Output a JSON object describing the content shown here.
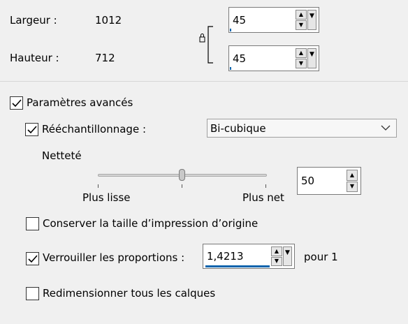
{
  "dimensions": {
    "width_label": "Largeur :",
    "width_value": "1012",
    "height_label": "Hauteur :",
    "height_value": "712",
    "width_spin_value": "45",
    "height_spin_value": "45",
    "lock_icon": "lock-icon"
  },
  "advanced": {
    "checkbox_label": "Paramètres avancés",
    "checked": true,
    "resample_label": "Rééchantillonnage :",
    "resample_checked": true,
    "resample_method": "Bi-cubique",
    "sharpness_label": "Netteté",
    "sharpness_value": "50",
    "sharpness_level_percent": 50,
    "slider_min_label": "Plus lisse",
    "slider_max_label": "Plus net",
    "keep_print_size_label": "Conserver la taille d’impression d’origine",
    "keep_print_size_checked": false,
    "lock_ratio_label": "Verrouiller les proportions :",
    "lock_ratio_checked": true,
    "ratio_value": "1,4213",
    "ratio_suffix": "pour 1",
    "resize_all_layers_label": "Redimensionner tous les calques",
    "resize_all_layers_checked": false
  },
  "colors": {
    "accent": "#0a64ad",
    "background": "#f0f0f0"
  }
}
